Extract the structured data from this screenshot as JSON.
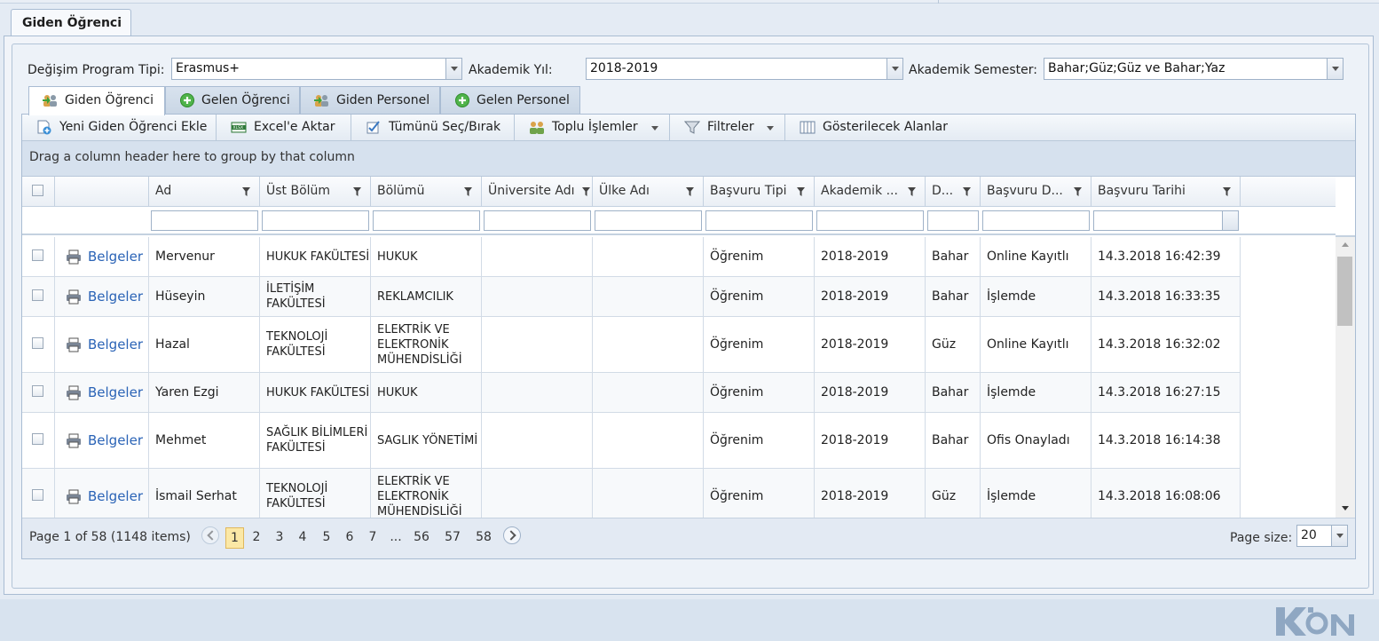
{
  "main_tab": {
    "label": "Giden Öğrenci"
  },
  "filters": {
    "program_label": "Değişim Program Tipi:",
    "program_value": "Erasmus+",
    "year_label": "Akademik Yıl:",
    "year_value": "2018-2019",
    "semester_label": "Akademik Semester:",
    "semester_value": "Bahar;Güz;Güz ve Bahar;Yaz"
  },
  "subtabs": [
    "Giden Öğrenci",
    "Gelen Öğrenci",
    "Giden Personel",
    "Gelen Personel"
  ],
  "toolbar": {
    "add": "Yeni Giden Öğrenci Ekle",
    "excel": "Excel'e Aktar",
    "select_all": "Tümünü Seç/Bırak",
    "bulk": "Toplu İşlemler",
    "filters": "Filtreler",
    "columns": "Gösterilecek Alanlar"
  },
  "group_panel": "Drag a column header here to group by that column",
  "columns": [
    "Ad",
    "Üst Bölüm",
    "Bölümü",
    "Üniversite Adı",
    "Ülke Adı",
    "Başvuru Tipi",
    "Akademik ...",
    "D...",
    "Başvuru D...",
    "Başvuru Tarihi"
  ],
  "link_label": "Belgeler",
  "rows": [
    {
      "ad": "Mervenur",
      "ust": "HUKUK FAKÜLTESİ",
      "bolum": "HUKUK",
      "uni": "",
      "ulke": "",
      "tip": "Öğrenim",
      "akad": "2018-2019",
      "donem": "Bahar",
      "durum": "Online Kayıtlı",
      "tarih": "14.3.2018 16:42:39"
    },
    {
      "ad": "Hüseyin",
      "ust": "İLETİŞİM FAKÜLTESİ",
      "bolum": "REKLAMCILIK",
      "uni": "",
      "ulke": "",
      "tip": "Öğrenim",
      "akad": "2018-2019",
      "donem": "Bahar",
      "durum": "İşlemde",
      "tarih": "14.3.2018 16:33:35"
    },
    {
      "ad": "Hazal",
      "ust": "TEKNOLOJİ FAKÜLTESİ",
      "bolum": "ELEKTRİK VE ELEKTRONİK MÜHENDİSLİĞİ",
      "uni": "",
      "ulke": "",
      "tip": "Öğrenim",
      "akad": "2018-2019",
      "donem": "Güz",
      "durum": "Online Kayıtlı",
      "tarih": "14.3.2018 16:32:02"
    },
    {
      "ad": "Yaren Ezgi",
      "ust": "HUKUK FAKÜLTESİ",
      "bolum": "HUKUK",
      "uni": "",
      "ulke": "",
      "tip": "Öğrenim",
      "akad": "2018-2019",
      "donem": "Bahar",
      "durum": "İşlemde",
      "tarih": "14.3.2018 16:27:15"
    },
    {
      "ad": "Mehmet",
      "ust": "SAĞLIK BİLİMLERİ FAKÜLTESİ",
      "bolum": "SAGLIK YÖNETİMİ",
      "uni": "",
      "ulke": "",
      "tip": "Öğrenim",
      "akad": "2018-2019",
      "donem": "Bahar",
      "durum": "Ofis Onayladı",
      "tarih": "14.3.2018 16:14:38"
    },
    {
      "ad": "İsmail Serhat",
      "ust": "TEKNOLOJİ FAKÜLTESİ",
      "bolum": "ELEKTRİK VE ELEKTRONİK MÜHENDİSLİĞİ",
      "uni": "",
      "ulke": "",
      "tip": "Öğrenim",
      "akad": "2018-2019",
      "donem": "Güz",
      "durum": "İşlemde",
      "tarih": "14.3.2018 16:08:06"
    }
  ],
  "pager": {
    "summary": "Page 1 of 58 (1148 items)",
    "pages": [
      "1",
      "2",
      "3",
      "4",
      "5",
      "6",
      "7",
      "...",
      "56",
      "57",
      "58"
    ],
    "current": "1",
    "page_size_label": "Page size:",
    "page_size": "20"
  },
  "logo_text": "KION",
  "colors": {
    "accent": "#2a63b6",
    "current_page_bg": "#fbe8a6"
  }
}
